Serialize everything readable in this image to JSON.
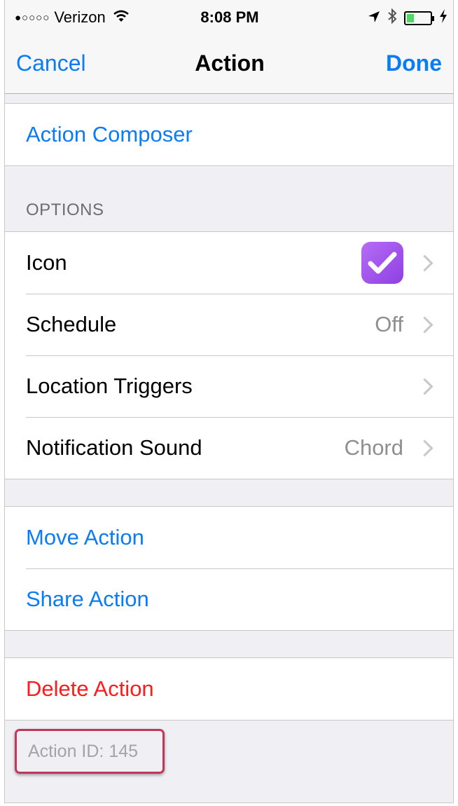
{
  "status_bar": {
    "signal_dots": "●○○○○",
    "carrier": "Verizon",
    "time": "8:08 PM",
    "icons": [
      "wifi-icon",
      "location-arrow-icon",
      "bluetooth-icon",
      "battery-icon",
      "charging-bolt-icon"
    ],
    "battery_fill_fraction": 0.3,
    "battery_color": "#4cd964"
  },
  "nav": {
    "cancel_label": "Cancel",
    "title": "Action",
    "done_label": "Done",
    "accent_color": "#0a7cf5"
  },
  "composer": {
    "label": "Action Composer"
  },
  "options": {
    "header": "OPTIONS",
    "icon_row": {
      "label": "Icon",
      "icon": "purple-checkmark-app-icon"
    },
    "schedule_row": {
      "label": "Schedule",
      "value": "Off"
    },
    "location_row": {
      "label": "Location Triggers"
    },
    "sound_row": {
      "label": "Notification Sound",
      "value": "Chord"
    }
  },
  "manage": {
    "move_label": "Move Action",
    "share_label": "Share Action"
  },
  "danger": {
    "delete_label": "Delete Action",
    "color": "#ff1b1b"
  },
  "footer": {
    "action_id": "Action ID: 145"
  }
}
